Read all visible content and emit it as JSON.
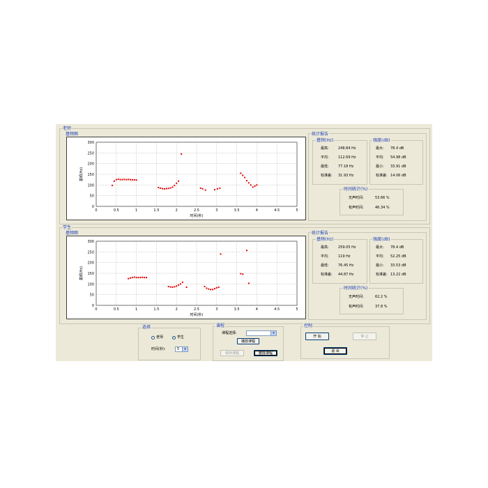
{
  "teacher": {
    "group_label": "老师",
    "plot_title": "基频图",
    "ylabel": "基频(Hz)",
    "xlabel": "时间(秒)",
    "stats_title": "统计报告",
    "freq_title": "基频(Hz)",
    "freq_rows": [
      {
        "label": "最高:",
        "value": "248.84 Hz"
      },
      {
        "label": "平均:",
        "value": "112.69 Hz"
      },
      {
        "label": "最低:",
        "value": "77.18 Hz"
      },
      {
        "label": "标准差:",
        "value": "31.93 Hz"
      }
    ],
    "int_title": "强度(dB)",
    "int_rows": [
      {
        "label": "最大:",
        "value": "78.4 dB"
      },
      {
        "label": "平均:",
        "value": "54.98 dB"
      },
      {
        "label": "最小:",
        "value": "33.91 dB"
      },
      {
        "label": "标准差:",
        "value": "14.06 dB"
      }
    ],
    "time_title": "时间统计(%)",
    "time_rows": [
      {
        "label": "无声时间:",
        "value": "53.66 %"
      },
      {
        "label": "有声时间:",
        "value": "46.34 %"
      }
    ]
  },
  "student": {
    "group_label": "学生",
    "plot_title": "基频图",
    "ylabel": "基频(Hz)",
    "xlabel": "时间(秒)",
    "stats_title": "统计报告",
    "freq_title": "基频(Hz)",
    "freq_rows": [
      {
        "label": "最高:",
        "value": "259.05 Hz"
      },
      {
        "label": "平均:",
        "value": "119 Hz"
      },
      {
        "label": "最低:",
        "value": "76.45 Hz"
      },
      {
        "label": "标准差:",
        "value": "44.87 Hz"
      }
    ],
    "int_title": "强度(dB)",
    "int_rows": [
      {
        "label": "最大:",
        "value": "78.4 dB"
      },
      {
        "label": "平均:",
        "value": "52.25 dB"
      },
      {
        "label": "最小:",
        "value": "33.53 dB"
      },
      {
        "label": "标准差:",
        "value": "13.22 dB"
      }
    ],
    "time_title": "时间统计(%)",
    "time_rows": [
      {
        "label": "无声时间:",
        "value": "62.2 %"
      },
      {
        "label": "有声时间:",
        "value": "37.8 %"
      }
    ]
  },
  "select_panel": {
    "title": "选择",
    "teacher_option": "老师",
    "student_option": "学生",
    "selected": "student",
    "time_label": "时间(秒):",
    "time_value": "5"
  },
  "course_panel": {
    "title": "课程",
    "course_label": "课程选择:",
    "course_value": "",
    "play_button": "播放课程",
    "save_button": "保存课程",
    "delete_button": "删除课程"
  },
  "control_panel": {
    "title": "控制",
    "start_button": "开 始",
    "stop_button": "停 止",
    "exit_button": "退 出"
  },
  "colors": {
    "accent_text": "#1f3fb5",
    "point": "#e00000",
    "panel_bg": "#ece9d8"
  },
  "chart_data": [
    {
      "type": "scatter",
      "title": "基频图",
      "xlabel": "时间(秒)",
      "ylabel": "基频(Hz)",
      "xlim": [
        0,
        5
      ],
      "ylim": [
        0,
        300
      ],
      "xticks": [
        0,
        0.5,
        1,
        1.5,
        2,
        2.5,
        3,
        3.5,
        4,
        4.5,
        5
      ],
      "yticks": [
        0,
        50,
        100,
        150,
        200,
        250,
        300
      ],
      "grid": true,
      "series": [
        {
          "x": [
            0.4,
            0.45,
            0.5,
            0.55,
            0.6,
            0.65,
            0.7,
            0.75,
            0.8,
            0.85,
            0.9,
            0.95,
            1.0,
            1.55,
            1.6,
            1.65,
            1.7,
            1.75,
            1.8,
            1.85,
            1.9,
            1.95,
            2.0,
            2.05,
            2.12,
            2.6,
            2.65,
            2.72,
            2.95,
            3.02,
            3.08,
            3.6,
            3.65,
            3.7,
            3.75,
            3.8,
            3.85,
            3.9,
            3.95,
            4.0
          ],
          "y": [
            98,
            118,
            125,
            127,
            125,
            125,
            126,
            125,
            126,
            125,
            124,
            124,
            123,
            88,
            85,
            83,
            82,
            83,
            84,
            86,
            90,
            98,
            108,
            118,
            245,
            85,
            82,
            76,
            78,
            82,
            85,
            155,
            145,
            135,
            120,
            110,
            100,
            90,
            95,
            100
          ]
        }
      ]
    },
    {
      "type": "scatter",
      "title": "基频图",
      "xlabel": "时间(秒)",
      "ylabel": "基频(Hz)",
      "xlim": [
        0,
        5
      ],
      "ylim": [
        0,
        300
      ],
      "xticks": [
        0,
        0.5,
        1,
        1.5,
        2,
        2.5,
        3,
        3.5,
        4,
        4.5,
        5
      ],
      "yticks": [
        0,
        50,
        100,
        150,
        200,
        250,
        300
      ],
      "grid": true,
      "series": [
        {
          "x": [
            0.8,
            0.85,
            0.9,
            0.95,
            1.0,
            1.05,
            1.1,
            1.15,
            1.2,
            1.25,
            1.8,
            1.85,
            1.9,
            1.95,
            2.0,
            2.05,
            2.1,
            2.15,
            2.25,
            2.7,
            2.75,
            2.8,
            2.85,
            2.9,
            2.95,
            3.0,
            3.05,
            3.1,
            3.6,
            3.65,
            3.75,
            3.8
          ],
          "y": [
            125,
            128,
            130,
            132,
            130,
            130,
            130,
            131,
            130,
            130,
            88,
            86,
            85,
            87,
            90,
            95,
            100,
            108,
            85,
            88,
            80,
            76,
            74,
            74,
            78,
            82,
            85,
            240,
            148,
            146,
            257,
            103
          ]
        }
      ]
    }
  ]
}
